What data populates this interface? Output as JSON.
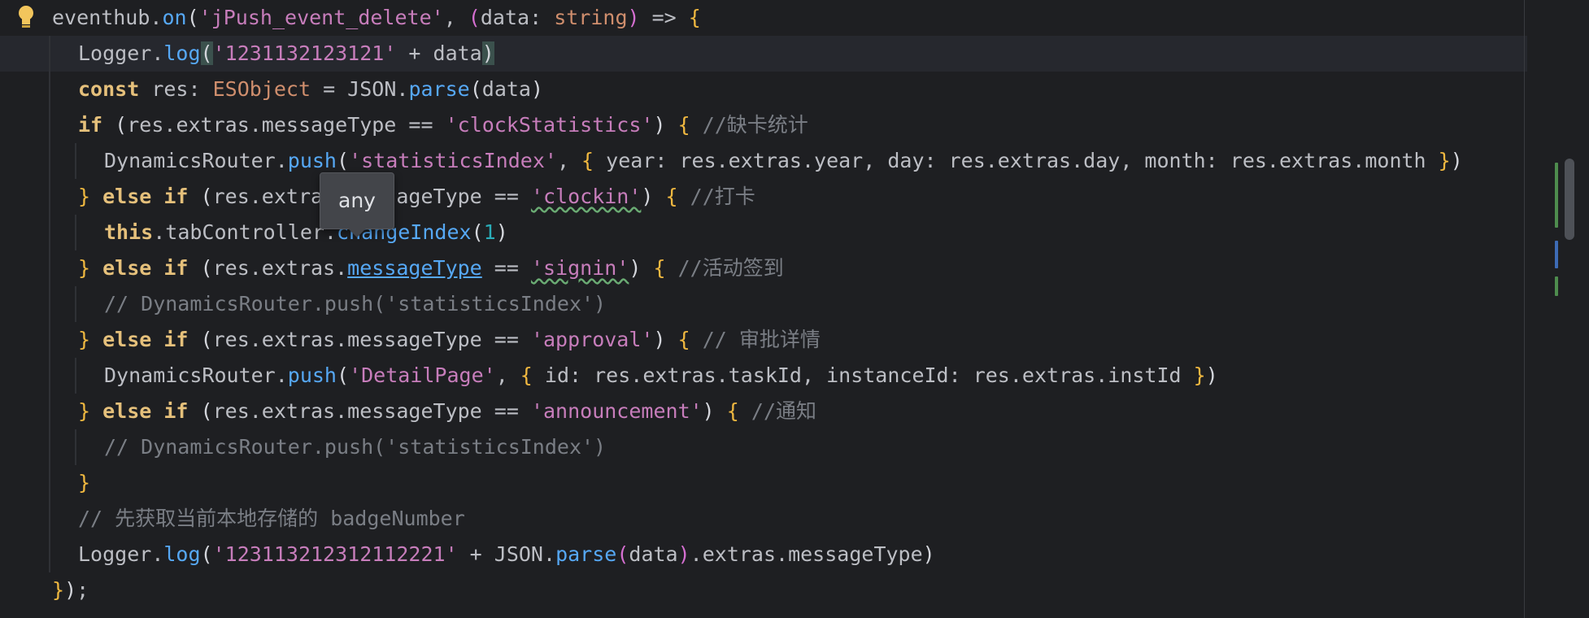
{
  "editor": {
    "lines": [
      {
        "id": "l1",
        "indent": 0,
        "current": false,
        "tokens": [
          {
            "t": "eventhub",
            "c": "t-default"
          },
          {
            "t": ".",
            "c": "t-default"
          },
          {
            "t": "on",
            "c": "t-fn"
          },
          {
            "t": "(",
            "c": "t-paren"
          },
          {
            "t": "'jPush_event_delete'",
            "c": "t-str"
          },
          {
            "t": ", ",
            "c": "t-default"
          },
          {
            "t": "(",
            "c": "t-paren2"
          },
          {
            "t": "data",
            "c": "t-default"
          },
          {
            "t": ": ",
            "c": "t-default"
          },
          {
            "t": "string",
            "c": "t-type"
          },
          {
            "t": ")",
            "c": "t-paren2"
          },
          {
            "t": " => ",
            "c": "t-default"
          },
          {
            "t": "{",
            "c": "t-brace"
          }
        ]
      },
      {
        "id": "l2",
        "indent": 1,
        "current": true,
        "tokens": [
          {
            "t": "Logger",
            "c": "t-default"
          },
          {
            "t": ".",
            "c": "t-default"
          },
          {
            "t": "log",
            "c": "t-fn"
          },
          {
            "t": "(",
            "c": "t-paren bracket-hl"
          },
          {
            "t": "'1231132123121'",
            "c": "t-str"
          },
          {
            "t": " + ",
            "c": "t-default"
          },
          {
            "t": "data",
            "c": "t-default"
          },
          {
            "t": ")",
            "c": "t-paren bracket-hl"
          }
        ]
      },
      {
        "id": "l3",
        "indent": 1,
        "current": false,
        "tokens": [
          {
            "t": "const",
            "c": "t-kw2"
          },
          {
            "t": " res",
            "c": "t-default"
          },
          {
            "t": ": ",
            "c": "t-default"
          },
          {
            "t": "ESObject",
            "c": "t-type"
          },
          {
            "t": " = ",
            "c": "t-default"
          },
          {
            "t": "JSON",
            "c": "t-default"
          },
          {
            "t": ".",
            "c": "t-default"
          },
          {
            "t": "parse",
            "c": "t-fn"
          },
          {
            "t": "(",
            "c": "t-paren"
          },
          {
            "t": "data",
            "c": "t-default"
          },
          {
            "t": ")",
            "c": "t-paren"
          }
        ]
      },
      {
        "id": "l4",
        "indent": 1,
        "current": false,
        "tokens": [
          {
            "t": "if",
            "c": "t-kw2"
          },
          {
            "t": " ",
            "c": "t-default"
          },
          {
            "t": "(",
            "c": "t-paren"
          },
          {
            "t": "res.extras.messageType",
            "c": "t-default"
          },
          {
            "t": " == ",
            "c": "t-default"
          },
          {
            "t": "'clockStatistics'",
            "c": "t-str"
          },
          {
            "t": ")",
            "c": "t-paren"
          },
          {
            "t": " ",
            "c": "t-default"
          },
          {
            "t": "{",
            "c": "t-brace"
          },
          {
            "t": " //缺卡统计",
            "c": "t-cmt"
          }
        ]
      },
      {
        "id": "l5",
        "indent": 2,
        "current": false,
        "tokens": [
          {
            "t": "DynamicsRouter",
            "c": "t-default"
          },
          {
            "t": ".",
            "c": "t-default"
          },
          {
            "t": "push",
            "c": "t-fn"
          },
          {
            "t": "(",
            "c": "t-paren"
          },
          {
            "t": "'statisticsIndex'",
            "c": "t-str"
          },
          {
            "t": ", ",
            "c": "t-default"
          },
          {
            "t": "{",
            "c": "t-brace"
          },
          {
            "t": " year: res.extras.year, day: res.extras.day, month: res.extras.month ",
            "c": "t-default"
          },
          {
            "t": "}",
            "c": "t-brace"
          },
          {
            "t": ")",
            "c": "t-paren"
          }
        ]
      },
      {
        "id": "l6",
        "indent": 1,
        "current": false,
        "tokens": [
          {
            "t": "}",
            "c": "t-brace"
          },
          {
            "t": " else if ",
            "c": "t-kw2"
          },
          {
            "t": "(",
            "c": "t-paren"
          },
          {
            "t": "res.extras.messageType",
            "c": "t-default"
          },
          {
            "t": " == ",
            "c": "t-default"
          },
          {
            "t": "'clockin'",
            "c": "t-str t-squig"
          },
          {
            "t": ")",
            "c": "t-paren"
          },
          {
            "t": " ",
            "c": "t-default"
          },
          {
            "t": "{",
            "c": "t-brace"
          },
          {
            "t": " //打卡",
            "c": "t-cmt"
          }
        ]
      },
      {
        "id": "l7",
        "indent": 2,
        "current": false,
        "tokens": [
          {
            "t": "this",
            "c": "t-kw2"
          },
          {
            "t": ".tabController.",
            "c": "t-default"
          },
          {
            "t": "changeIndex",
            "c": "t-fn"
          },
          {
            "t": "(",
            "c": "t-paren"
          },
          {
            "t": "1",
            "c": "t-num"
          },
          {
            "t": ")",
            "c": "t-paren"
          }
        ]
      },
      {
        "id": "l8",
        "indent": 1,
        "current": false,
        "tokens": [
          {
            "t": "}",
            "c": "t-brace"
          },
          {
            "t": " else if ",
            "c": "t-kw2"
          },
          {
            "t": "(",
            "c": "t-paren"
          },
          {
            "t": "res.extras.",
            "c": "t-default"
          },
          {
            "t": "messageType",
            "c": "t-link"
          },
          {
            "t": " == ",
            "c": "t-default"
          },
          {
            "t": "'signin'",
            "c": "t-str t-squig"
          },
          {
            "t": ")",
            "c": "t-paren"
          },
          {
            "t": " ",
            "c": "t-default"
          },
          {
            "t": "{",
            "c": "t-brace"
          },
          {
            "t": " //活动签到",
            "c": "t-cmt"
          }
        ]
      },
      {
        "id": "l9",
        "indent": 2,
        "current": false,
        "tokens": [
          {
            "t": "// DynamicsRouter.push('statisticsIndex')",
            "c": "t-cmt"
          }
        ]
      },
      {
        "id": "l10",
        "indent": 1,
        "current": false,
        "tokens": [
          {
            "t": "}",
            "c": "t-brace"
          },
          {
            "t": " else if ",
            "c": "t-kw2"
          },
          {
            "t": "(",
            "c": "t-paren"
          },
          {
            "t": "res.extras.messageType",
            "c": "t-default"
          },
          {
            "t": " == ",
            "c": "t-default"
          },
          {
            "t": "'approval'",
            "c": "t-str"
          },
          {
            "t": ")",
            "c": "t-paren"
          },
          {
            "t": " ",
            "c": "t-default"
          },
          {
            "t": "{",
            "c": "t-brace"
          },
          {
            "t": " // 审批详情",
            "c": "t-cmt"
          }
        ]
      },
      {
        "id": "l11",
        "indent": 2,
        "current": false,
        "tokens": [
          {
            "t": "DynamicsRouter",
            "c": "t-default"
          },
          {
            "t": ".",
            "c": "t-default"
          },
          {
            "t": "push",
            "c": "t-fn"
          },
          {
            "t": "(",
            "c": "t-paren"
          },
          {
            "t": "'DetailPage'",
            "c": "t-str"
          },
          {
            "t": ", ",
            "c": "t-default"
          },
          {
            "t": "{",
            "c": "t-brace"
          },
          {
            "t": " id: res.extras.taskId, instanceId: res.extras.instId ",
            "c": "t-default"
          },
          {
            "t": "}",
            "c": "t-brace"
          },
          {
            "t": ")",
            "c": "t-paren"
          }
        ]
      },
      {
        "id": "l12",
        "indent": 1,
        "current": false,
        "tokens": [
          {
            "t": "}",
            "c": "t-brace"
          },
          {
            "t": " else if ",
            "c": "t-kw2"
          },
          {
            "t": "(",
            "c": "t-paren"
          },
          {
            "t": "res.extras.messageType",
            "c": "t-default"
          },
          {
            "t": " == ",
            "c": "t-default"
          },
          {
            "t": "'announcement'",
            "c": "t-str"
          },
          {
            "t": ")",
            "c": "t-paren"
          },
          {
            "t": " ",
            "c": "t-default"
          },
          {
            "t": "{",
            "c": "t-brace"
          },
          {
            "t": " //通知",
            "c": "t-cmt"
          }
        ]
      },
      {
        "id": "l13",
        "indent": 2,
        "current": false,
        "tokens": [
          {
            "t": "// DynamicsRouter.push('statisticsIndex')",
            "c": "t-cmt"
          }
        ]
      },
      {
        "id": "l14",
        "indent": 1,
        "current": false,
        "tokens": [
          {
            "t": "}",
            "c": "t-brace"
          }
        ]
      },
      {
        "id": "l15",
        "indent": 1,
        "current": false,
        "tokens": [
          {
            "t": "// 先获取当前本地存储的 badgeNumber",
            "c": "t-cmt"
          }
        ]
      },
      {
        "id": "l16",
        "indent": 1,
        "current": false,
        "tokens": [
          {
            "t": "Logger",
            "c": "t-default"
          },
          {
            "t": ".",
            "c": "t-default"
          },
          {
            "t": "log",
            "c": "t-fn"
          },
          {
            "t": "(",
            "c": "t-paren"
          },
          {
            "t": "'123113212312112221'",
            "c": "t-str"
          },
          {
            "t": " + ",
            "c": "t-default"
          },
          {
            "t": "JSON",
            "c": "t-default"
          },
          {
            "t": ".",
            "c": "t-default"
          },
          {
            "t": "parse",
            "c": "t-fn"
          },
          {
            "t": "(",
            "c": "t-paren2"
          },
          {
            "t": "data",
            "c": "t-default"
          },
          {
            "t": ")",
            "c": "t-paren2"
          },
          {
            "t": ".extras.messageType",
            "c": "t-default"
          },
          {
            "t": ")",
            "c": "t-paren"
          }
        ]
      },
      {
        "id": "l17",
        "indent": 0,
        "current": false,
        "tokens": [
          {
            "t": "}",
            "c": "t-brace"
          },
          {
            "t": ")",
            "c": "t-paren"
          },
          {
            "t": ";",
            "c": "t-default"
          }
        ]
      }
    ]
  },
  "tooltip": {
    "text": "any"
  },
  "gutter_icon": "lightbulb-icon",
  "change_marks": [
    {
      "color": "#4e8c4e"
    },
    {
      "color": "#4e8c4e"
    },
    {
      "color": "#3d6bb5"
    },
    {
      "color": "#4e8c4e"
    }
  ]
}
